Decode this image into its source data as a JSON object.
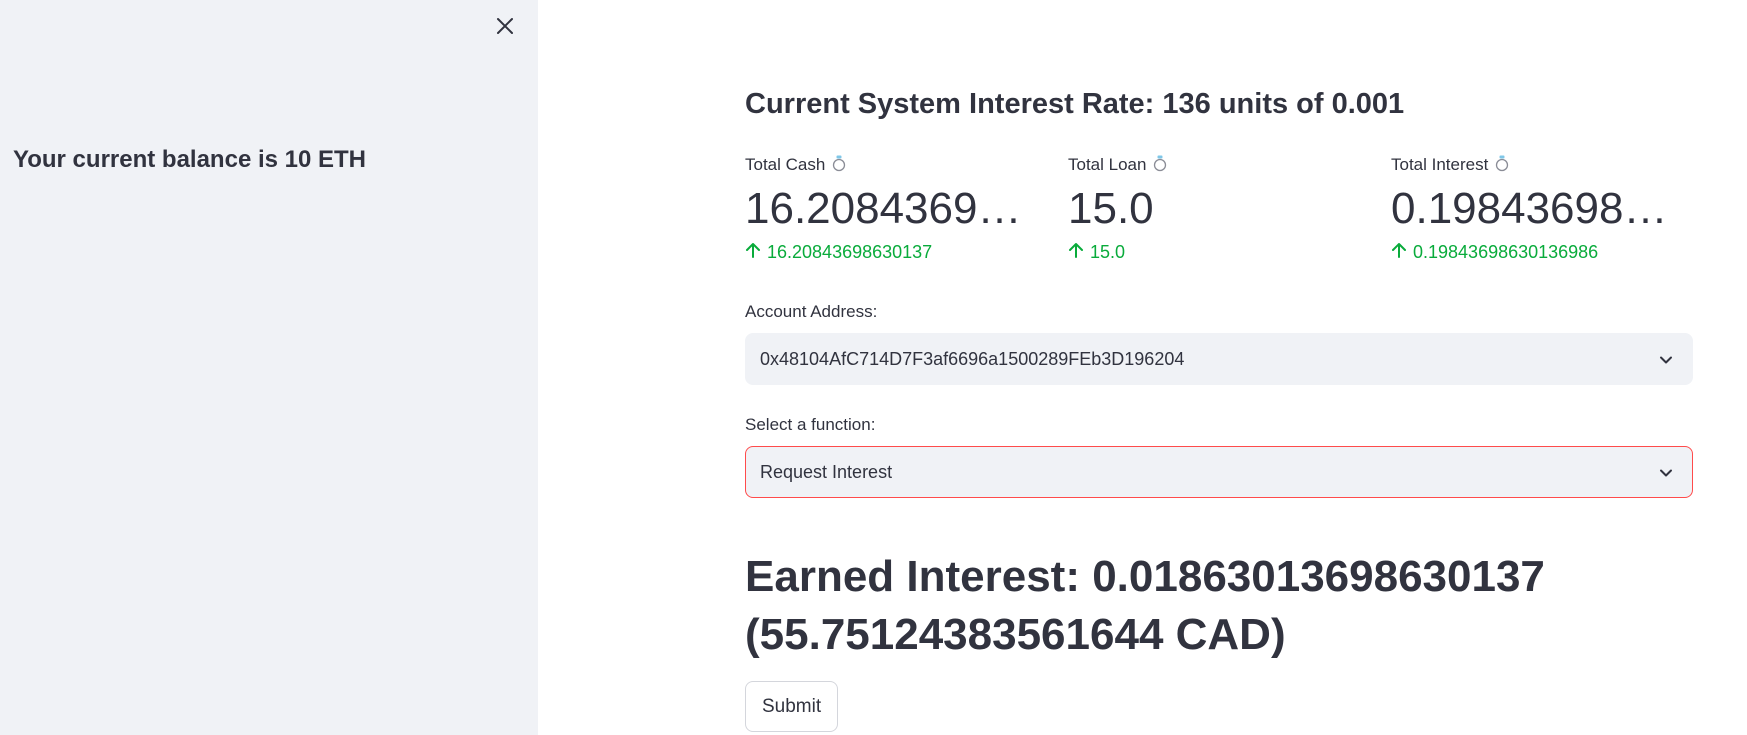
{
  "sidebar": {
    "close_icon": "close-icon",
    "balance_text": "Your current balance is 10 ETH"
  },
  "main": {
    "rate_title": "Current System Interest Rate: 136 units of 0.001",
    "metrics": [
      {
        "label": "Total Cash",
        "value": "16.20843698630137",
        "delta": "16.20843698630137",
        "help_icon": "help-icon",
        "delta_icon": "arrow-up-icon"
      },
      {
        "label": "Total Loan",
        "value": "15.0",
        "delta": "15.0",
        "help_icon": "help-icon",
        "delta_icon": "arrow-up-icon"
      },
      {
        "label": "Total Interest",
        "value": "0.19843698630136986",
        "delta": "0.19843698630136986",
        "help_icon": "help-icon",
        "delta_icon": "arrow-up-icon"
      }
    ],
    "account": {
      "label": "Account Address:",
      "value": "0x48104AfC714D7F3af6696a1500289FEb3D196204"
    },
    "function_select": {
      "label": "Select a function:",
      "value": "Request Interest"
    },
    "earned_text": "Earned Interest: 0.018630136986301​37 (55.75124383561644 CAD)",
    "submit_label": "Submit"
  },
  "colors": {
    "sidebar_bg": "#f0f2f6",
    "text": "#31333f",
    "delta_green": "#09ab3b",
    "focus_red": "#ff4b4b"
  }
}
